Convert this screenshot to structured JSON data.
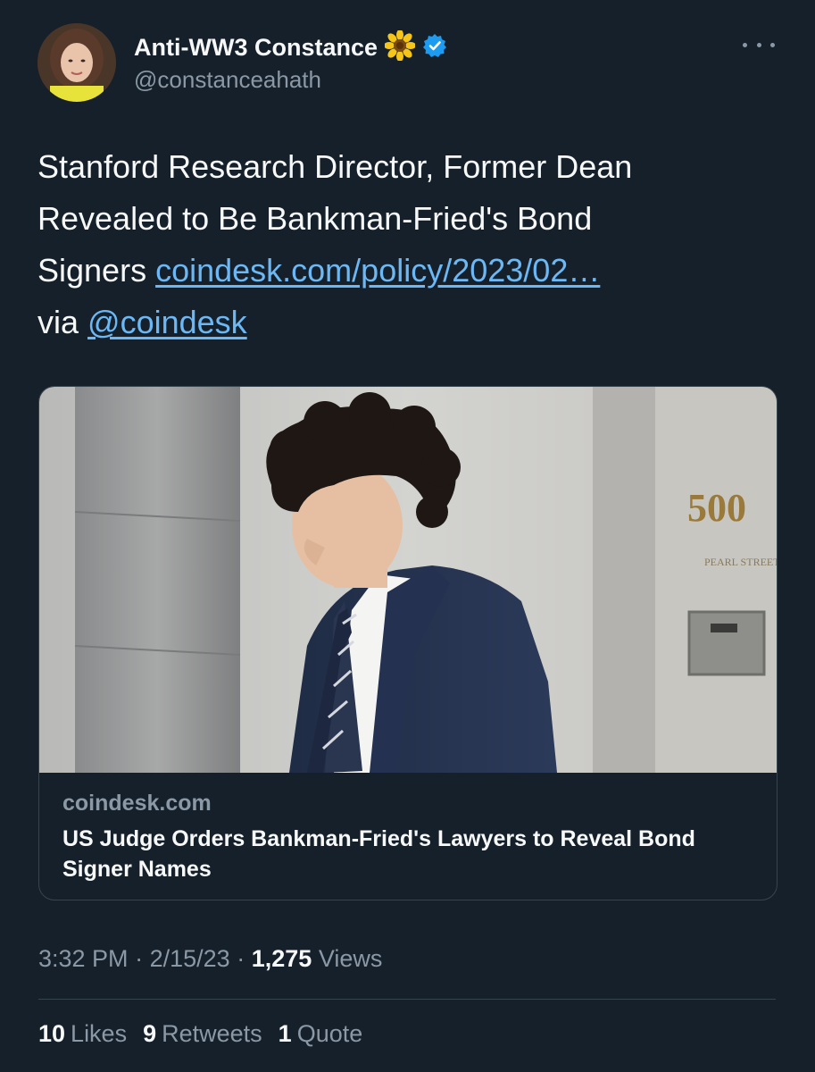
{
  "author": {
    "display_name": "Anti-WW3 Constance",
    "handle": "@constanceahath"
  },
  "tweet": {
    "text_line1": "Stanford Research Director, Former Dean",
    "text_line2": "Revealed to Be Bankman-Fried's Bond",
    "text_line3_prefix": "Signers",
    "link": "coindesk.com/policy/2023/02…",
    "via_prefix": "via",
    "mention": "@coindesk"
  },
  "card": {
    "domain": "coindesk.com",
    "title": "US Judge Orders Bankman-Fried's Lawyers to Reveal Bond Signer Names",
    "sign_number": "500",
    "sign_text": "PEARL STREET"
  },
  "meta": {
    "time": "3:32 PM",
    "date": "2/15/23",
    "views_count": "1,275",
    "views_label": "Views",
    "separator": "·"
  },
  "stats": {
    "likes_count": "10",
    "likes_label": "Likes",
    "retweets_count": "9",
    "retweets_label": "Retweets",
    "quotes_count": "1",
    "quotes_label": "Quote"
  },
  "colors": {
    "background": "#15202b",
    "link": "#6cb8f5",
    "muted": "#8b98a5",
    "verified": "#1d9bf0"
  }
}
